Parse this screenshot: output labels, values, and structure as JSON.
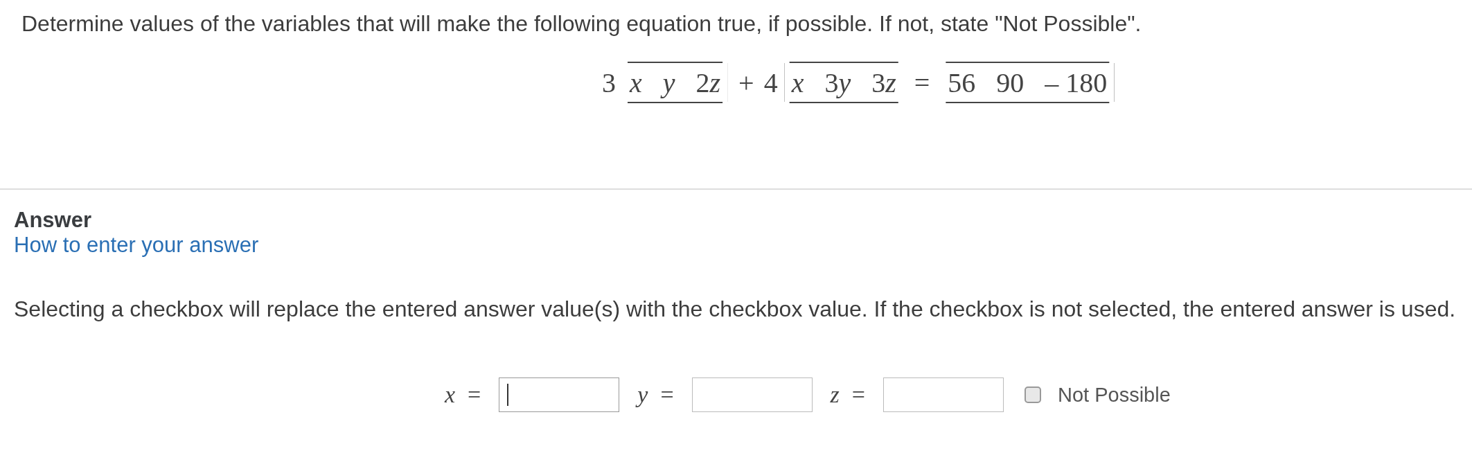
{
  "question": {
    "prompt": "Determine values of the variables that will make the following equation true, if possible. If not, state \"Not Possible\".",
    "equation": {
      "terms": [
        {
          "coefficient": "3",
          "entries": [
            {
              "variable": "x"
            },
            {
              "variable": "y"
            },
            {
              "number": "2",
              "variable": "z"
            }
          ]
        },
        {
          "operator": "+",
          "coefficient": "4",
          "entries": [
            {
              "variable": "x"
            },
            {
              "number": "3",
              "variable": "y"
            },
            {
              "number": "3",
              "variable": "z"
            }
          ]
        }
      ],
      "equals": "=",
      "result": [
        "56",
        "90",
        "– 180"
      ]
    }
  },
  "answer": {
    "heading": "Answer",
    "help_link": "How to enter your answer",
    "note": "Selecting a checkbox will replace the entered answer value(s) with the checkbox value. If the checkbox is not selected, the entered answer is used.",
    "fields": [
      {
        "variable": "x",
        "equals": "=",
        "focused": true
      },
      {
        "variable": "y",
        "equals": "=",
        "focused": false
      },
      {
        "variable": "z",
        "equals": "=",
        "focused": false
      }
    ],
    "checkbox": {
      "label": "Not Possible",
      "checked": false
    }
  }
}
